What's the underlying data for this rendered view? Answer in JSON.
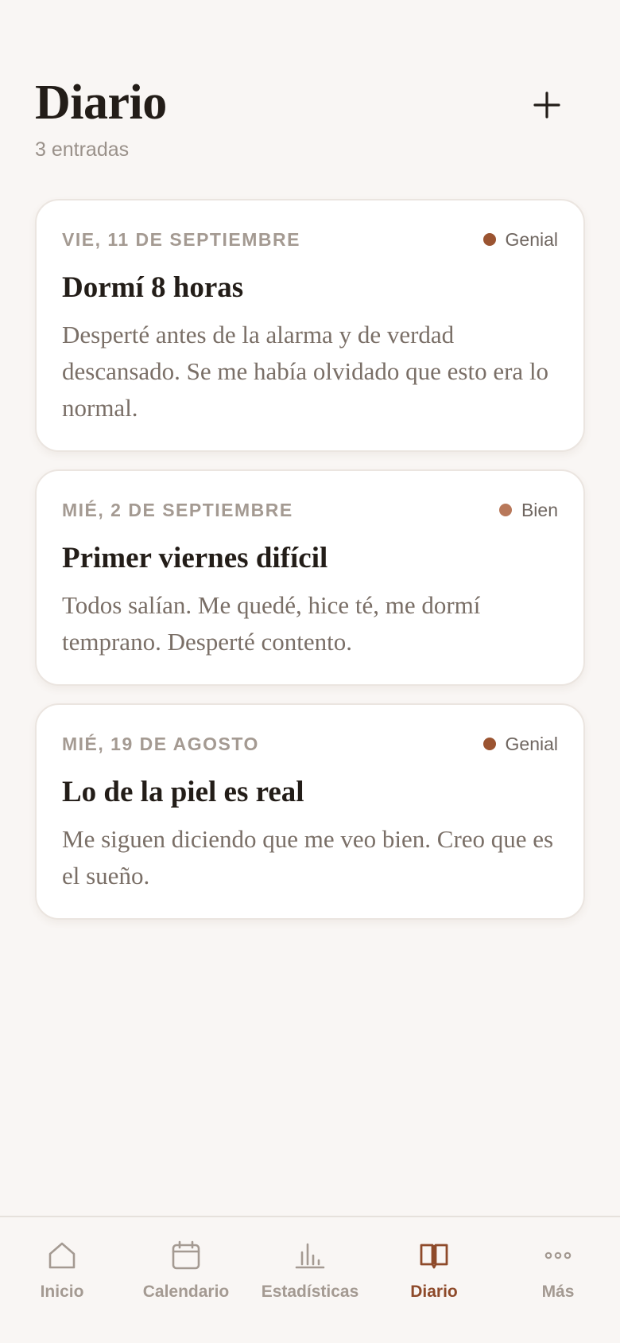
{
  "header": {
    "title": "Diario",
    "subtitle": "3 entradas",
    "add_icon": "plus-icon"
  },
  "entries": [
    {
      "date": "VIE, 11 DE SEPTIEMBRE",
      "mood": "Genial",
      "mood_color": "#9b5431",
      "title": "Dormí 8 horas",
      "body": "Desperté antes de la alarma y de verdad descansado. Se me había olvidado que esto era lo normal."
    },
    {
      "date": "MIÉ, 2 DE SEPTIEMBRE",
      "mood": "Bien",
      "mood_color": "#b8785a",
      "title": "Primer viernes difícil",
      "body": "Todos salían. Me quedé, hice té, me dormí temprano. Desperté contento."
    },
    {
      "date": "MIÉ, 19 DE AGOSTO",
      "mood": "Genial",
      "mood_color": "#9b5431",
      "title": "Lo de la piel es real",
      "body": "Me siguen diciendo que me veo bien. Creo que es el sueño."
    }
  ],
  "tabbar": {
    "active_color": "#8e4a2a",
    "inactive_color": "#a49a92",
    "items": [
      {
        "label": "Inicio",
        "icon": "home-icon",
        "active": false
      },
      {
        "label": "Calendario",
        "icon": "calendar-icon",
        "active": false
      },
      {
        "label": "Estadísticas",
        "icon": "bar-chart-icon",
        "active": false
      },
      {
        "label": "Diario",
        "icon": "book-icon",
        "active": true
      },
      {
        "label": "Más",
        "icon": "more-icon",
        "active": false
      }
    ]
  }
}
